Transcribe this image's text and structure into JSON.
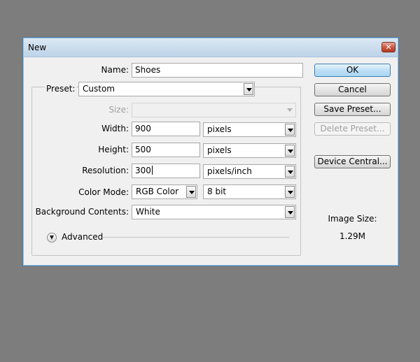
{
  "window": {
    "title": "New",
    "close_glyph": "✕"
  },
  "form": {
    "name": {
      "label": "Name:",
      "value": "Shoes"
    },
    "preset": {
      "label": "Preset:",
      "value": "Custom"
    },
    "size": {
      "label": "Size:",
      "value": ""
    },
    "width": {
      "label": "Width:",
      "value": "900",
      "unit": "pixels"
    },
    "height": {
      "label": "Height:",
      "value": "500",
      "unit": "pixels"
    },
    "resolution": {
      "label": "Resolution:",
      "value": "300",
      "unit": "pixels/inch"
    },
    "color_mode": {
      "label": "Color Mode:",
      "value": "RGB Color",
      "depth": "8 bit"
    },
    "background": {
      "label": "Background Contents:",
      "value": "White"
    },
    "advanced": {
      "label": "Advanced"
    }
  },
  "buttons": {
    "ok": "OK",
    "cancel": "Cancel",
    "save_preset": "Save Preset...",
    "delete_preset": "Delete Preset...",
    "device_central": "Device Central..."
  },
  "image_size": {
    "label": "Image Size:",
    "value": "1.29M"
  },
  "colors": {
    "desktop": "#7d7d7d",
    "dialog": "#f0f0f0",
    "ok_button": "#bfe0f6"
  }
}
